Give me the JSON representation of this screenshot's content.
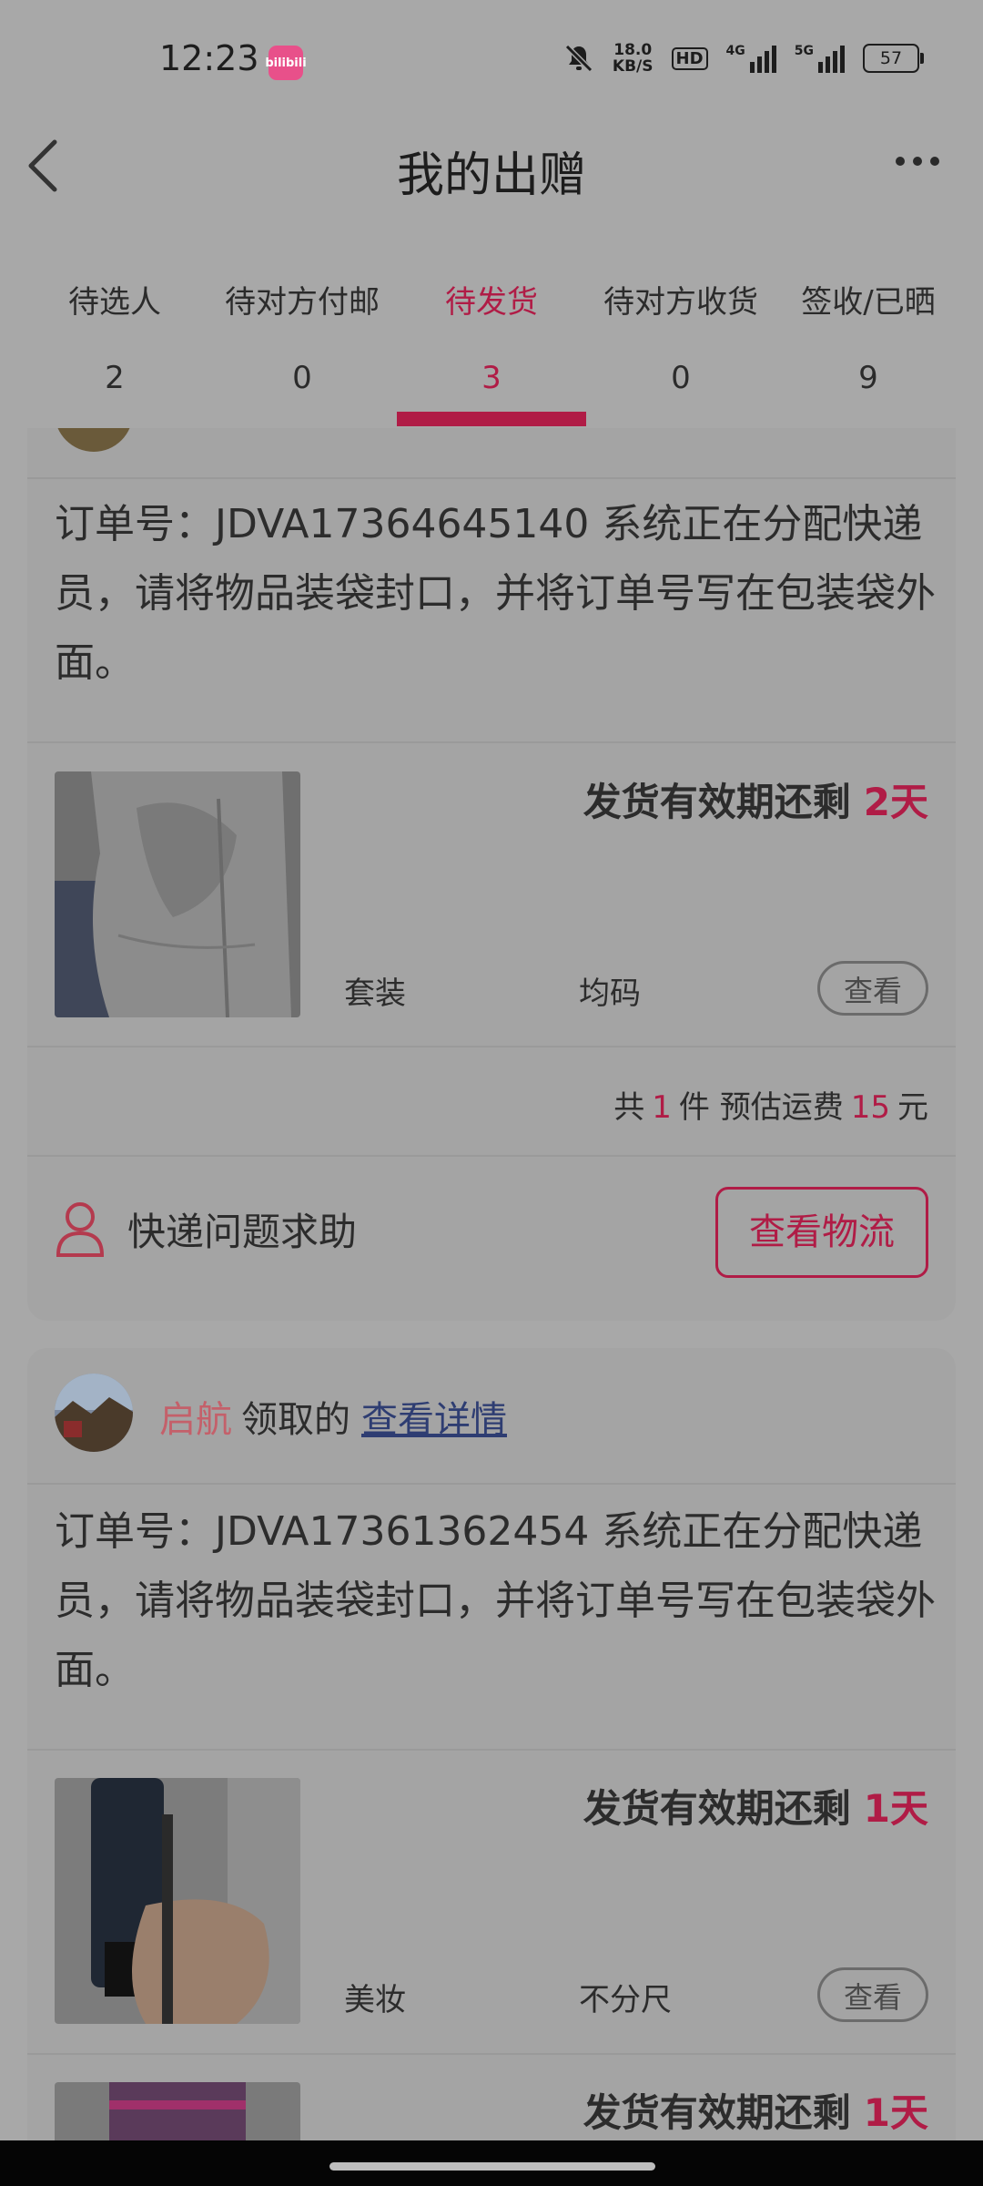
{
  "status_bar": {
    "time": "12:23",
    "app_badge": "bilibili",
    "net_speed_value": "18.0",
    "net_speed_unit": "KB/S",
    "hd_label": "HD",
    "sig1_label": "4G",
    "sig2_label": "5G",
    "battery": "57"
  },
  "nav": {
    "title": "我的出赠"
  },
  "tabs": [
    {
      "label": "待选人",
      "count": "2"
    },
    {
      "label": "待对方付邮",
      "count": "0"
    },
    {
      "label": "待发货",
      "count": "3"
    },
    {
      "label": "待对方收货",
      "count": "0"
    },
    {
      "label": "签收/已晒",
      "count": "9"
    }
  ],
  "order1": {
    "order_text": "订单号：JDVA17364645140 系统正在分配快递员，请将物品装袋封口，并将订单号写在包装袋外面。",
    "deadline_prefix": "发货有效期还剩",
    "deadline_days": "2天",
    "category": "套装",
    "size": "均码",
    "view_label": "查看",
    "summary_pre": "共",
    "summary_count": "1",
    "summary_mid": "件 预估运费",
    "summary_fee": "15",
    "summary_post": "元",
    "help_label": "快递问题求助",
    "logistics_label": "查看物流"
  },
  "order2": {
    "claimer": "启航",
    "claim_text": "领取的",
    "details_link": "查看详情",
    "order_text": "订单号：JDVA17361362454 系统正在分配快递员，请将物品装袋封口，并将订单号写在包装袋外面。",
    "deadline_prefix": "发货有效期还剩",
    "deadline_days": "1天",
    "category": "美妆",
    "size": "不分尺",
    "view_label": "查看",
    "item2_deadline_prefix": "发货有效期还剩",
    "item2_deadline_days": "1天"
  },
  "colors": {
    "accent": "#b01c46",
    "background": "#a8a8a8",
    "link": "#2e3d72"
  }
}
